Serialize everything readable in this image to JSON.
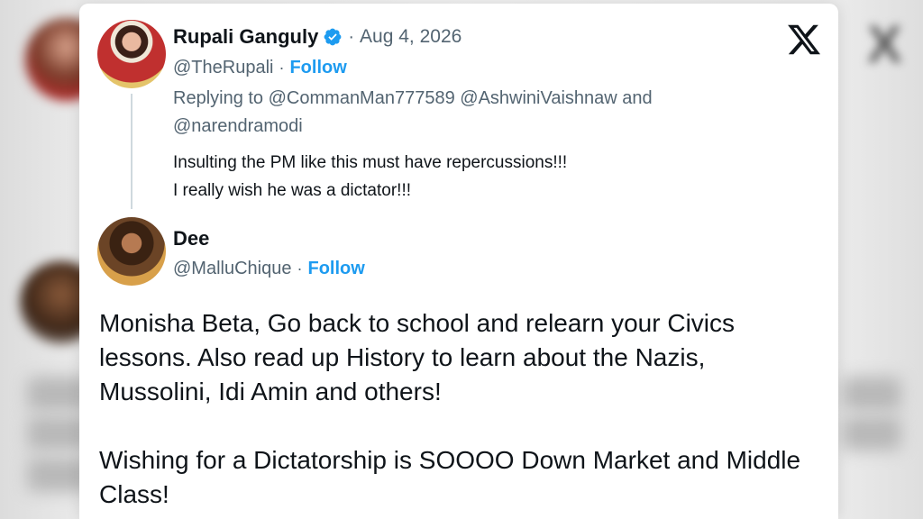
{
  "reply_tweet": {
    "author_name": "Rupali Ganguly",
    "verified_icon": "verified-badge-icon",
    "separator": "·",
    "date": "Aug 4, 2026",
    "handle": "@TheRupali",
    "handle_separator": "·",
    "follow_label": "Follow",
    "replying_prefix": "Replying to",
    "mention_1": "@CommanMan777589",
    "mention_2": "@AshwiniVaishnaw",
    "and_word": "and",
    "mention_3": "@narendramodi",
    "text_line_1": "Insulting the PM like this must have repercussions!!!",
    "text_line_2": "I really wish he was a dictator!!!"
  },
  "quote_tweet": {
    "author_name": "Dee",
    "handle": "@MalluChique",
    "handle_separator": "·",
    "follow_label": "Follow",
    "paragraph_1": "Monisha Beta, Go back to school and relearn your Civics lessons. Also read up History to learn about the Nazis, Mussolini, Idi Amin and others!",
    "paragraph_2": "Wishing for a Dictatorship is SOOOO Down Market and Middle Class!"
  },
  "logo": "x-logo-icon",
  "colors": {
    "link_blue": "#1d9bf0",
    "text_primary": "#0f1419",
    "text_secondary": "#536471"
  }
}
